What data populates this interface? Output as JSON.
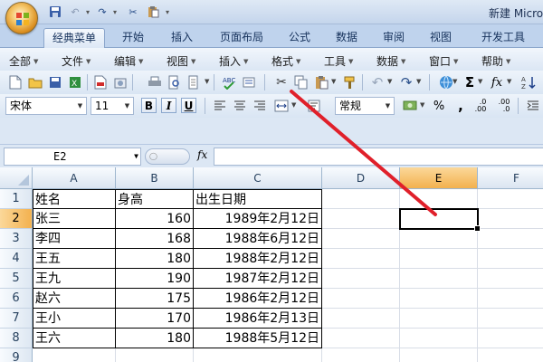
{
  "window": {
    "title": "新建 Micro"
  },
  "ribbon_tabs": [
    "经典菜单",
    "开始",
    "插入",
    "页面布局",
    "公式",
    "数据",
    "审阅",
    "视图",
    "开发工具"
  ],
  "active_tab": "经典菜单",
  "menus": [
    "全部",
    "文件",
    "编辑",
    "视图",
    "插入",
    "格式",
    "工具",
    "数据",
    "窗口",
    "帮助"
  ],
  "format_bar": {
    "font_name": "宋体",
    "font_size": "11",
    "bold": "B",
    "italic": "I",
    "underline": "U",
    "number_format": "常规",
    "percent": "%",
    "comma": ",",
    "inc_decimal": ".0\n.00",
    "dec_decimal": ".00\n.0"
  },
  "formula_bar": {
    "name_box": "E2",
    "fx_label": "fx",
    "formula": ""
  },
  "columns": [
    "A",
    "B",
    "C",
    "D",
    "E",
    "F"
  ],
  "selected_column": "E",
  "rows": [
    "1",
    "2",
    "3",
    "4",
    "5",
    "6",
    "7",
    "8",
    "9"
  ],
  "selected_row": "2",
  "table": {
    "headers": [
      "姓名",
      "身高",
      "出生日期"
    ],
    "rows": [
      [
        "张三",
        "160",
        "1989年2月12日"
      ],
      [
        "李四",
        "168",
        "1988年6月12日"
      ],
      [
        "王五",
        "180",
        "1988年2月12日"
      ],
      [
        "王九",
        "190",
        "1987年2月12日"
      ],
      [
        "赵六",
        "175",
        "1986年2月12日"
      ],
      [
        "王小",
        "170",
        "1986年2月13日"
      ],
      [
        "王六",
        "180",
        "1988年5月12日"
      ]
    ]
  },
  "colors": {
    "annotation_arrow": "#e0202a",
    "selection_header": "#f3b14e"
  }
}
